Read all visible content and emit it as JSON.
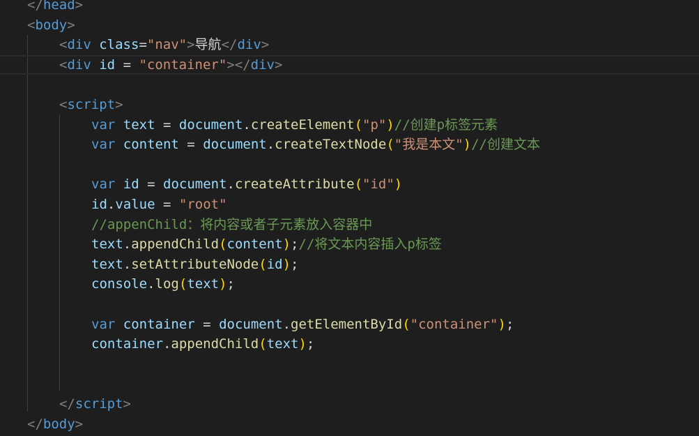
{
  "editor": {
    "lines": [
      {
        "indent": 0,
        "tokens": [
          {
            "t": "</",
            "c": "punc"
          },
          {
            "t": "head",
            "c": "tag"
          },
          {
            "t": ">",
            "c": "punc"
          }
        ]
      },
      {
        "indent": 0,
        "tokens": [
          {
            "t": "<",
            "c": "punc"
          },
          {
            "t": "body",
            "c": "tag"
          },
          {
            "t": ">",
            "c": "punc"
          }
        ]
      },
      {
        "indent": 1,
        "tokens": [
          {
            "t": "<",
            "c": "punc"
          },
          {
            "t": "div",
            "c": "tag"
          },
          {
            "t": " ",
            "c": "text"
          },
          {
            "t": "class",
            "c": "attr"
          },
          {
            "t": "=",
            "c": "op"
          },
          {
            "t": "\"nav\"",
            "c": "str"
          },
          {
            "t": ">",
            "c": "punc"
          },
          {
            "t": "导航",
            "c": "text"
          },
          {
            "t": "</",
            "c": "punc"
          },
          {
            "t": "div",
            "c": "tag"
          },
          {
            "t": ">",
            "c": "punc"
          }
        ]
      },
      {
        "indent": 1,
        "active": true,
        "tokens": [
          {
            "t": "<",
            "c": "punc"
          },
          {
            "t": "div",
            "c": "tag"
          },
          {
            "t": " ",
            "c": "text"
          },
          {
            "t": "id",
            "c": "attr"
          },
          {
            "t": " = ",
            "c": "op"
          },
          {
            "t": "\"container\"",
            "c": "str"
          },
          {
            "t": ">",
            "c": "punc"
          },
          {
            "t": "</",
            "c": "punc"
          },
          {
            "t": "div",
            "c": "tag"
          },
          {
            "t": ">",
            "c": "punc"
          }
        ]
      },
      {
        "indent": 0,
        "tokens": []
      },
      {
        "indent": 1,
        "tokens": [
          {
            "t": "<",
            "c": "punc"
          },
          {
            "t": "script",
            "c": "tag"
          },
          {
            "t": ">",
            "c": "punc"
          }
        ]
      },
      {
        "indent": 2,
        "tokens": [
          {
            "t": "var",
            "c": "kw"
          },
          {
            "t": " ",
            "c": "text"
          },
          {
            "t": "text",
            "c": "var"
          },
          {
            "t": " = ",
            "c": "op"
          },
          {
            "t": "document",
            "c": "var"
          },
          {
            "t": ".",
            "c": "op"
          },
          {
            "t": "createElement",
            "c": "fn"
          },
          {
            "t": "(",
            "c": "paren"
          },
          {
            "t": "\"p\"",
            "c": "str"
          },
          {
            "t": ")",
            "c": "paren"
          },
          {
            "t": "//创建p标签元素",
            "c": "comment"
          }
        ]
      },
      {
        "indent": 2,
        "tokens": [
          {
            "t": "var",
            "c": "kw"
          },
          {
            "t": " ",
            "c": "text"
          },
          {
            "t": "content",
            "c": "var"
          },
          {
            "t": " = ",
            "c": "op"
          },
          {
            "t": "document",
            "c": "var"
          },
          {
            "t": ".",
            "c": "op"
          },
          {
            "t": "createTextNode",
            "c": "fn"
          },
          {
            "t": "(",
            "c": "paren"
          },
          {
            "t": "\"我是本文\"",
            "c": "str"
          },
          {
            "t": ")",
            "c": "paren"
          },
          {
            "t": "//创建文本",
            "c": "comment"
          }
        ]
      },
      {
        "indent": 0,
        "tokens": []
      },
      {
        "indent": 2,
        "tokens": [
          {
            "t": "var",
            "c": "kw"
          },
          {
            "t": " ",
            "c": "text"
          },
          {
            "t": "id",
            "c": "var"
          },
          {
            "t": " = ",
            "c": "op"
          },
          {
            "t": "document",
            "c": "var"
          },
          {
            "t": ".",
            "c": "op"
          },
          {
            "t": "createAttribute",
            "c": "fn"
          },
          {
            "t": "(",
            "c": "paren"
          },
          {
            "t": "\"id\"",
            "c": "str"
          },
          {
            "t": ")",
            "c": "paren"
          }
        ]
      },
      {
        "indent": 2,
        "tokens": [
          {
            "t": "id",
            "c": "var"
          },
          {
            "t": ".",
            "c": "op"
          },
          {
            "t": "value",
            "c": "var"
          },
          {
            "t": " = ",
            "c": "op"
          },
          {
            "t": "\"root\"",
            "c": "str"
          }
        ]
      },
      {
        "indent": 2,
        "tokens": [
          {
            "t": "//appenChild：将内容或者子元素放入容器中",
            "c": "comment"
          }
        ]
      },
      {
        "indent": 2,
        "tokens": [
          {
            "t": "text",
            "c": "var"
          },
          {
            "t": ".",
            "c": "op"
          },
          {
            "t": "appendChild",
            "c": "fn"
          },
          {
            "t": "(",
            "c": "paren"
          },
          {
            "t": "content",
            "c": "var"
          },
          {
            "t": ")",
            "c": "paren"
          },
          {
            "t": ";",
            "c": "op"
          },
          {
            "t": "//将文本内容插入p标签",
            "c": "comment"
          }
        ]
      },
      {
        "indent": 2,
        "tokens": [
          {
            "t": "text",
            "c": "var"
          },
          {
            "t": ".",
            "c": "op"
          },
          {
            "t": "setAttributeNode",
            "c": "fn"
          },
          {
            "t": "(",
            "c": "paren"
          },
          {
            "t": "id",
            "c": "var"
          },
          {
            "t": ")",
            "c": "paren"
          },
          {
            "t": ";",
            "c": "op"
          }
        ]
      },
      {
        "indent": 2,
        "tokens": [
          {
            "t": "console",
            "c": "var"
          },
          {
            "t": ".",
            "c": "op"
          },
          {
            "t": "log",
            "c": "fn"
          },
          {
            "t": "(",
            "c": "paren"
          },
          {
            "t": "text",
            "c": "var"
          },
          {
            "t": ")",
            "c": "paren"
          },
          {
            "t": ";",
            "c": "op"
          }
        ]
      },
      {
        "indent": 0,
        "tokens": []
      },
      {
        "indent": 2,
        "tokens": [
          {
            "t": "var",
            "c": "kw"
          },
          {
            "t": " ",
            "c": "text"
          },
          {
            "t": "container",
            "c": "var"
          },
          {
            "t": " = ",
            "c": "op"
          },
          {
            "t": "document",
            "c": "var"
          },
          {
            "t": ".",
            "c": "op"
          },
          {
            "t": "getElementById",
            "c": "fn"
          },
          {
            "t": "(",
            "c": "paren"
          },
          {
            "t": "\"container\"",
            "c": "str"
          },
          {
            "t": ")",
            "c": "paren"
          },
          {
            "t": ";",
            "c": "op"
          }
        ]
      },
      {
        "indent": 2,
        "tokens": [
          {
            "t": "container",
            "c": "var"
          },
          {
            "t": ".",
            "c": "op"
          },
          {
            "t": "appendChild",
            "c": "fn"
          },
          {
            "t": "(",
            "c": "paren"
          },
          {
            "t": "text",
            "c": "var"
          },
          {
            "t": ")",
            "c": "paren"
          },
          {
            "t": ";",
            "c": "op"
          }
        ]
      },
      {
        "indent": 0,
        "tokens": []
      },
      {
        "indent": 0,
        "tokens": []
      },
      {
        "indent": 1,
        "tokens": [
          {
            "t": "</",
            "c": "punc"
          },
          {
            "t": "script",
            "c": "tag"
          },
          {
            "t": ">",
            "c": "punc"
          }
        ]
      },
      {
        "indent": 0,
        "tokens": [
          {
            "t": "</",
            "c": "punc"
          },
          {
            "t": "body",
            "c": "tag"
          },
          {
            "t": ">",
            "c": "punc"
          }
        ]
      }
    ]
  }
}
